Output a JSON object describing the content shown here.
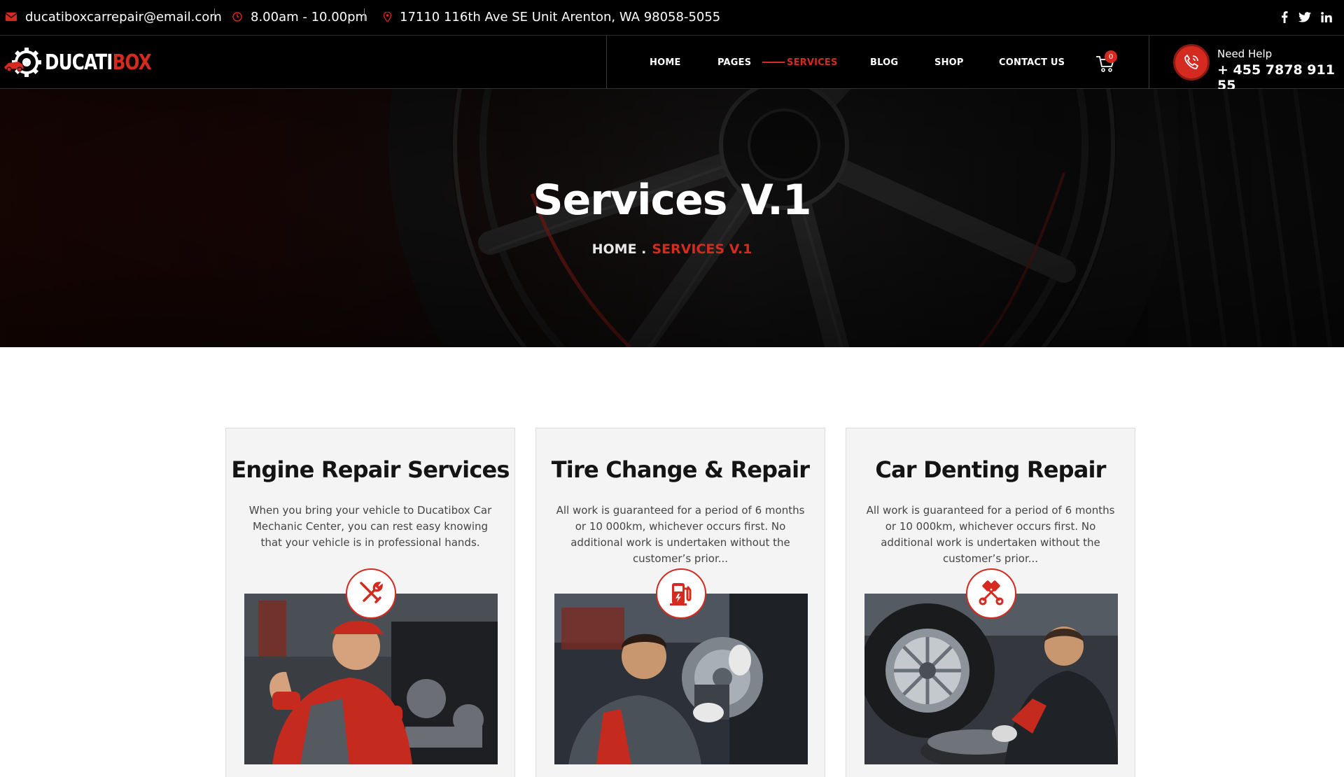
{
  "topbar": {
    "email": "ducatiboxcarrepair@email.com",
    "hours": "8.00am - 10.00pm",
    "address": "17110 116th Ave SE Unit Arenton, WA 98058-5055",
    "social_icons": [
      "facebook-icon",
      "twitter-icon",
      "linkedin-icon"
    ]
  },
  "brand": {
    "name_part1": "DUCATI",
    "name_part2": "BOX",
    "accent": "#d42a1f"
  },
  "nav": {
    "items": [
      {
        "label": "HOME"
      },
      {
        "label": "PAGES"
      },
      {
        "label": "SERVICES",
        "active": true
      },
      {
        "label": "BLOG"
      },
      {
        "label": "SHOP"
      },
      {
        "label": "CONTACT US"
      }
    ],
    "cart_count": "0"
  },
  "help": {
    "label": "Need Help",
    "phone": "+ 455 7878 911 55"
  },
  "hero": {
    "title": "Services V.1",
    "breadcrumb_home": "HOME .",
    "breadcrumb_current": "SERVICES V.1"
  },
  "services": [
    {
      "title": "Engine Repair Services",
      "description": "When you bring your vehicle to Ducatibox Car Mechanic Center, you can rest easy knowing that your vehicle is in professional hands.",
      "icon": "wrench-screwdriver-icon"
    },
    {
      "title": "Tire Change & Repair",
      "description": "All work is guaranteed for a period of 6 months or 10 000km, whichever occurs first. No additional work is undertaken without the customer’s prior...",
      "icon": "fuel-pump-icon"
    },
    {
      "title": "Car Denting Repair",
      "description": "All work is guaranteed for a period of 6 months or 10 000km, whichever occurs first. No additional work is undertaken without the customer’s prior...",
      "icon": "pistons-icon"
    }
  ]
}
